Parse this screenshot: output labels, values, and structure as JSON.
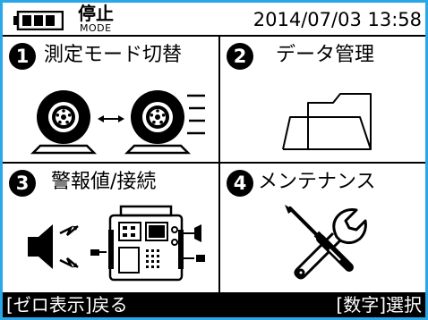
{
  "header": {
    "mode_label": "停止",
    "mode_sub": "MODE",
    "datetime": "2014/07/03 13:58"
  },
  "menu": [
    {
      "number": "1",
      "label": "測定モード切替",
      "icon": "tire-mode-switch-icon"
    },
    {
      "number": "2",
      "label": "データ管理",
      "icon": "folder-icon"
    },
    {
      "number": "3",
      "label": "警報値/接続",
      "icon": "alarm-connection-icon"
    },
    {
      "number": "4",
      "label": "メンテナンス",
      "icon": "tools-icon"
    }
  ],
  "footer": {
    "back": "[ゼロ表示]戻る",
    "select": "[数字]選択"
  },
  "colors": {
    "frame": "#2aa7e6",
    "foreground": "#000000",
    "background": "#ffffff"
  }
}
